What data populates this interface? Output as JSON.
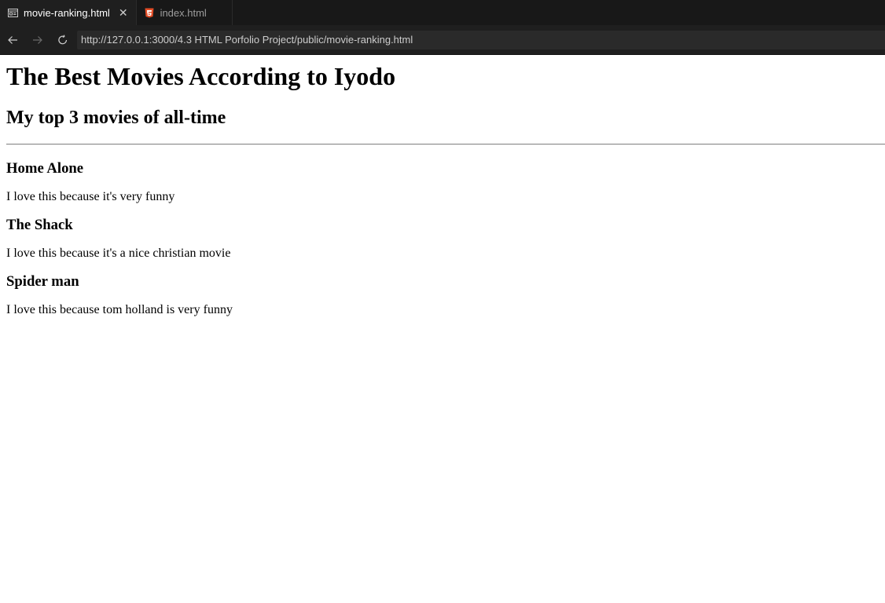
{
  "browser": {
    "tabs": [
      {
        "label": "movie-ranking.html",
        "icon": "preview-icon",
        "active": true
      },
      {
        "label": "index.html",
        "icon": "html5-icon",
        "active": false
      }
    ],
    "url": "http://127.0.0.1:3000/4.3 HTML Porfolio Project/public/movie-ranking.html",
    "accent": "#e44d26"
  },
  "page": {
    "title": "The Best Movies According to Iyodo",
    "subtitle": "My top 3 movies of all-time",
    "movies": [
      {
        "name": "Home Alone",
        "reason": "I love this because it's very funny"
      },
      {
        "name": "The Shack",
        "reason": "I love this because it's a nice christian movie"
      },
      {
        "name": "Spider man",
        "reason": "I love this because tom holland is very funny"
      }
    ]
  }
}
